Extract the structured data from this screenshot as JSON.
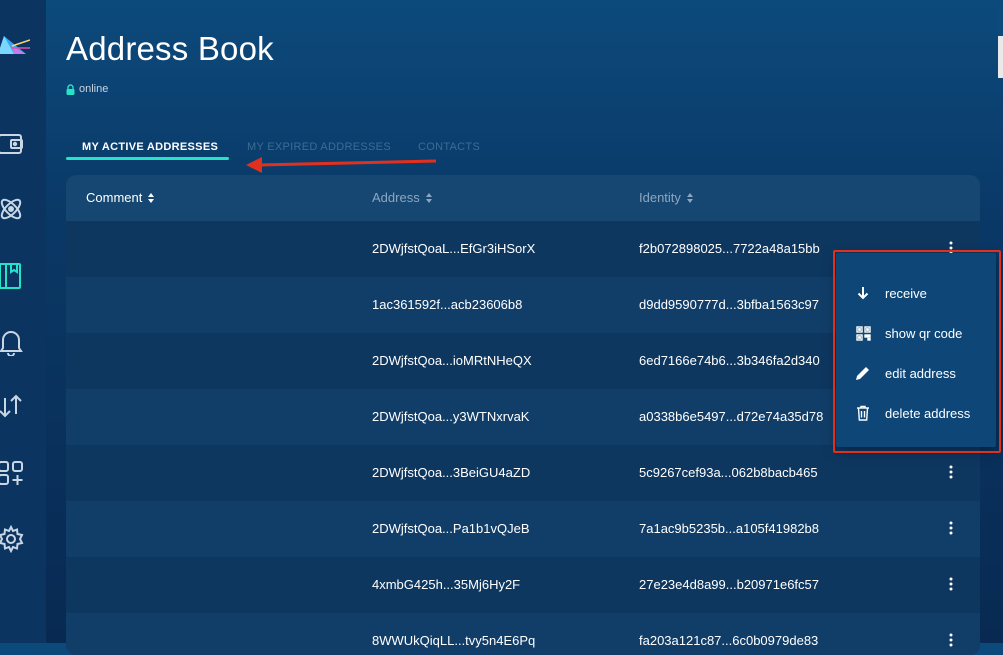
{
  "header": {
    "title": "Address Book",
    "status": "online"
  },
  "tabs": [
    {
      "label": "MY ACTIVE ADDRESSES",
      "active": true
    },
    {
      "label": "MY EXPIRED ADDRESSES",
      "active": false
    },
    {
      "label": "CONTACTS",
      "active": false
    }
  ],
  "table": {
    "columns": [
      "Comment",
      "Address",
      "Identity"
    ],
    "rows": [
      {
        "comment": "",
        "address": "2DWjfstQoaL...EfGr3iHSorX",
        "identity": "f2b072898025...7722a48a15bb"
      },
      {
        "comment": "",
        "address": "1ac361592f...acb23606b8",
        "identity": "d9dd9590777d...3bfba1563c97"
      },
      {
        "comment": "",
        "address": "2DWjfstQoa...ioMRtNHeQX",
        "identity": "6ed7166e74b6...3b346fa2d340"
      },
      {
        "comment": "",
        "address": "2DWjfstQoa...y3WTNxrvaK",
        "identity": "a0338b6e5497...d72e74a35d78"
      },
      {
        "comment": "",
        "address": "2DWjfstQoa...3BeiGU4aZD",
        "identity": "5c9267cef93a...062b8bacb465"
      },
      {
        "comment": "",
        "address": "2DWjfstQoa...Pa1b1vQJeB",
        "identity": "7a1ac9b5235b...a105f41982b8"
      },
      {
        "comment": "",
        "address": "4xmbG425h...35Mj6Hy2F",
        "identity": "27e23e4d8a99...b20971e6fc57"
      },
      {
        "comment": "",
        "address": "8WWUkQiqLL...tvy5n4E6Pq",
        "identity": "fa203a121c87...6c0b0979de83"
      }
    ]
  },
  "context_menu": {
    "items": [
      {
        "label": "receive",
        "icon": "arrow-down-icon"
      },
      {
        "label": "show qr code",
        "icon": "qr-code-icon"
      },
      {
        "label": "edit address",
        "icon": "pencil-icon"
      },
      {
        "label": "delete address",
        "icon": "trash-icon"
      }
    ]
  },
  "colors": {
    "accent": "#24e3c8",
    "annotation": "#e2301e",
    "background": "#0a3866"
  }
}
